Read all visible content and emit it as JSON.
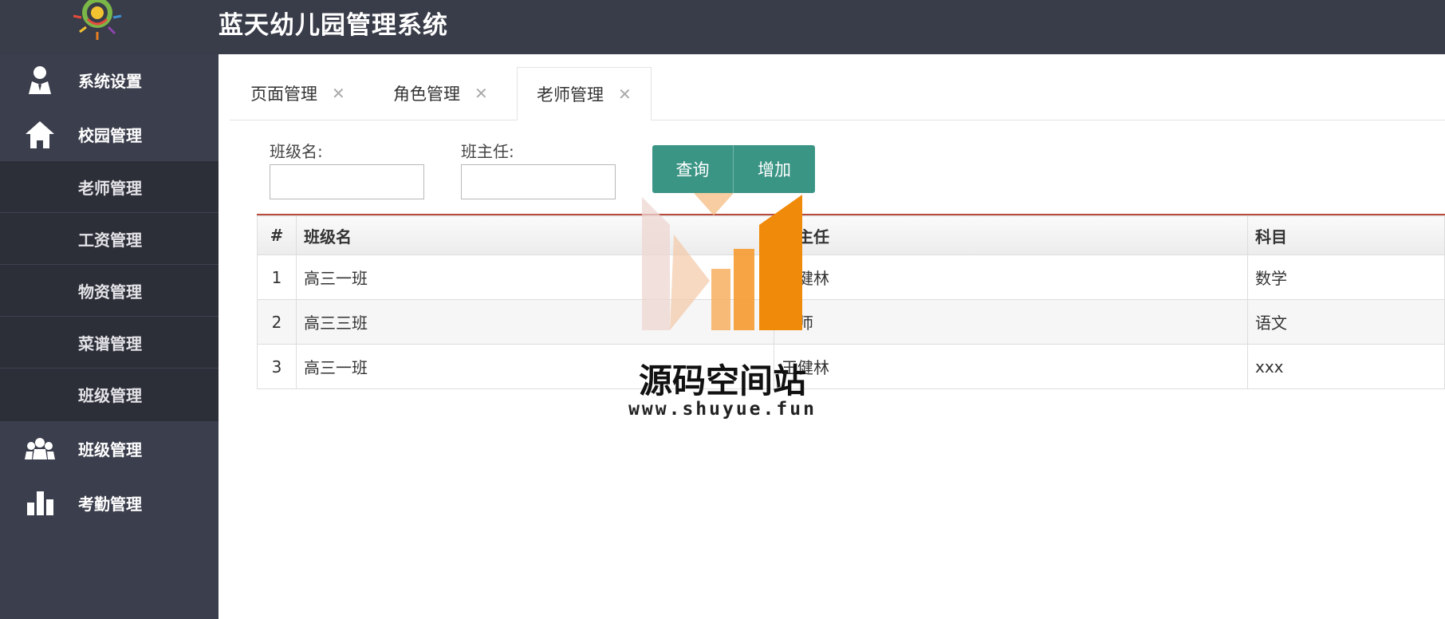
{
  "header": {
    "title": "蓝天幼儿园管理系统"
  },
  "sidebar": {
    "groups": [
      {
        "label": "系统设置",
        "icon": "user-icon"
      },
      {
        "label": "校园管理",
        "icon": "home-icon"
      },
      {
        "label": "班级管理",
        "icon": "group-icon"
      },
      {
        "label": "考勤管理",
        "icon": "bar-chart-icon"
      }
    ],
    "submenu": [
      {
        "label": "老师管理"
      },
      {
        "label": "工资管理"
      },
      {
        "label": "物资管理"
      },
      {
        "label": "菜谱管理"
      },
      {
        "label": "班级管理"
      }
    ]
  },
  "tabs": [
    {
      "label": "页面管理",
      "active": false
    },
    {
      "label": "角色管理",
      "active": false
    },
    {
      "label": "老师管理",
      "active": true
    }
  ],
  "search": {
    "class_name_label": "班级名:",
    "class_name_value": "",
    "head_teacher_label": "班主任:",
    "head_teacher_value": "",
    "query_button": "查询",
    "add_button": "增加"
  },
  "table": {
    "headers": [
      "#",
      "班级名",
      "班主任",
      "科目"
    ],
    "rows": [
      [
        "1",
        "高三一班",
        "王健林",
        "数学"
      ],
      [
        "2",
        "高三三班",
        "老师",
        "语文"
      ],
      [
        "3",
        "高三一班",
        "王健林",
        "xxx"
      ]
    ]
  },
  "watermark": {
    "name": "源码空间站",
    "url": "www.shuyue.fun"
  },
  "colors": {
    "header_bg": "#393c49",
    "sidebar_bg": "#3b3e4c",
    "submenu_bg": "#2c2e38",
    "button": "#3b9585",
    "accent_line": "#b84a3e"
  }
}
